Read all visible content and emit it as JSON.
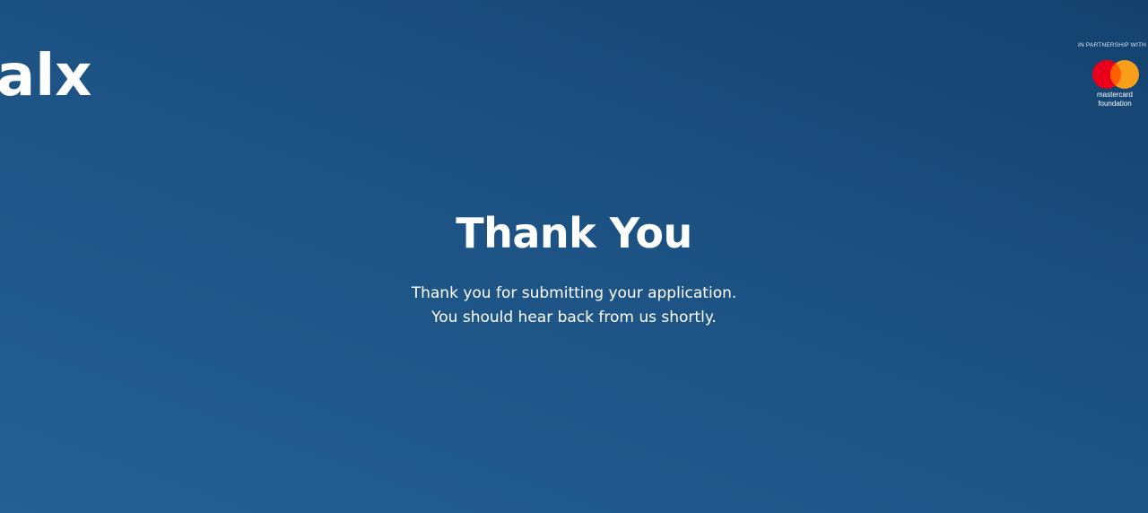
{
  "brand": {
    "logo_text": "alx"
  },
  "partner": {
    "caption": "IN PARTNERSHIP WITH",
    "name_line1": "mastercard",
    "name_line2": "foundation",
    "colors": {
      "red": "#eb001b",
      "orange": "#f79e1b",
      "overlap": "#ff5f00"
    }
  },
  "main": {
    "heading": "Thank You",
    "message_line1": "Thank you for submitting your application.",
    "message_line2": "You should hear back from us shortly."
  },
  "colors": {
    "background_top": "#13426f",
    "background_bottom": "#255f94",
    "text": "#ffffff"
  }
}
